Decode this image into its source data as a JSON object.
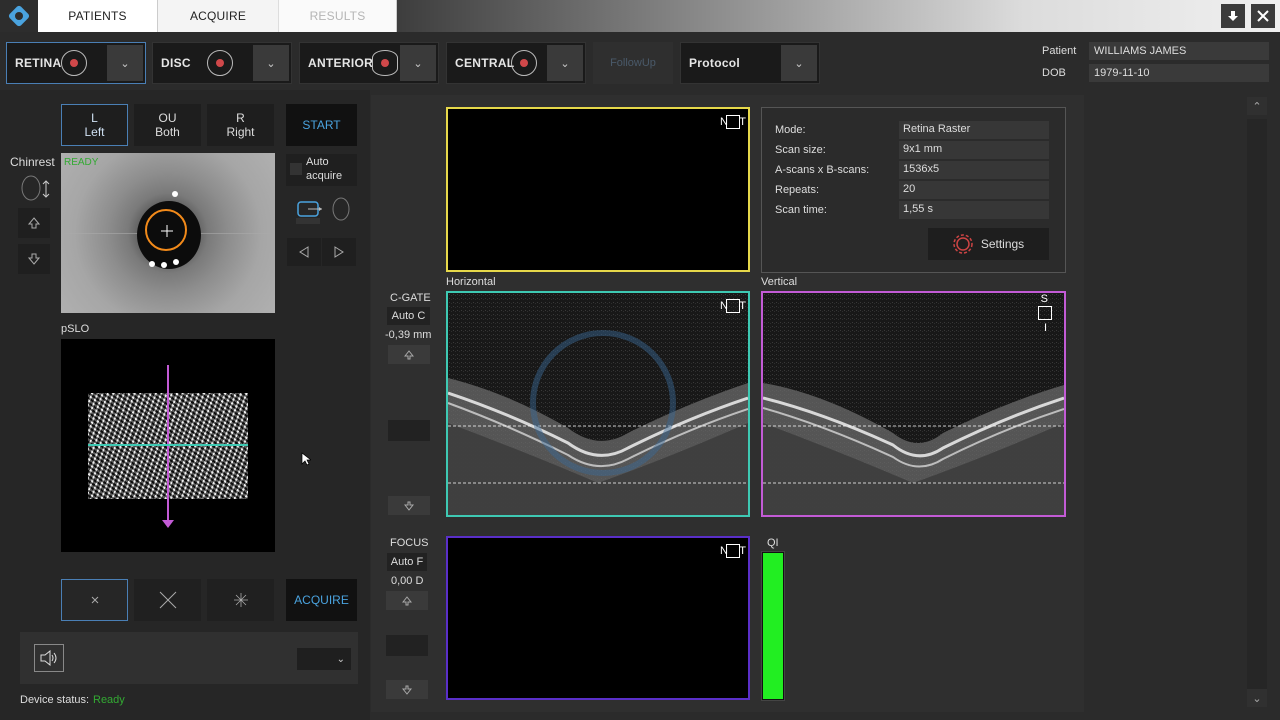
{
  "tabs": {
    "patients": "PATIENTS",
    "acquire": "ACQUIRE",
    "results": "RESULTS"
  },
  "window": {
    "download_icon": "download-icon",
    "close_icon": "close-icon"
  },
  "modes": [
    {
      "label": "RETINA",
      "badge": "R"
    },
    {
      "label": "DISC",
      "badge": "D"
    },
    {
      "label": "ANTERIOR",
      "badge": "A"
    },
    {
      "label": "CENTRAL",
      "badge": "C"
    }
  ],
  "followup": "FollowUp",
  "protocol": "Protocol",
  "patient": {
    "name_label": "Patient",
    "name": "WILLIAMS JAMES",
    "dob_label": "DOB",
    "dob": "1979-11-10"
  },
  "eye": {
    "left_top": "L",
    "left_bottom": "Left",
    "both_top": "OU",
    "both_bottom": "Both",
    "right_top": "R",
    "right_bottom": "Right"
  },
  "start": "START",
  "auto_acquire": "Auto acquire",
  "chinrest": "Chinrest",
  "iris_status": "READY",
  "pslo_label": "pSLO",
  "acquire": "ACQUIRE",
  "device_status_label": "Device status:",
  "device_status": "Ready",
  "cgate": {
    "label": "C-GATE",
    "mode": "Auto C",
    "value": "-0,39 mm"
  },
  "focus": {
    "label": "FOCUS",
    "mode": "Auto F",
    "value": "0,00 D"
  },
  "horizontal_label": "Horizontal",
  "vertical_label": "Vertical",
  "qi_label": "QI",
  "qi_value": 1.0,
  "orient": {
    "n": "N",
    "t": "T",
    "s": "S",
    "i": "I"
  },
  "scan": {
    "mode_label": "Mode:",
    "mode": "Retina Raster",
    "size_label": "Scan size:",
    "size": "9x1 mm",
    "ascan_label": "A-scans x B-scans:",
    "ascan": "1536x5",
    "repeats_label": "Repeats:",
    "repeats": "20",
    "time_label": "Scan time:",
    "time": "1,55 s",
    "settings": "Settings"
  },
  "colors": {
    "yellow": "#e6d84a",
    "teal": "#3ec9b3",
    "magenta": "#c35bd6",
    "purple": "#5a2fc9",
    "qi_green": "#22ee22",
    "ready_green": "#33aa33"
  }
}
